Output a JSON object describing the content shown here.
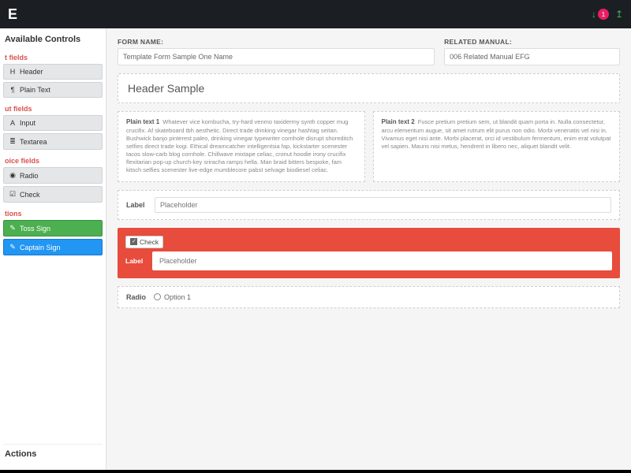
{
  "topbar": {
    "logo_suffix": "E",
    "notif_count": "1"
  },
  "sidebar": {
    "title": "Available Controls",
    "cat_text": "t fields",
    "header_ctrl": "Header",
    "plaintext_ctrl": "Plain Text",
    "cat_input": "ut fields",
    "input_ctrl": "Input",
    "textarea_ctrl": "Textarea",
    "cat_choice": "oice fields",
    "radio_ctrl": "Radio",
    "check_ctrl": "Check",
    "cat_actions": "tions",
    "tosssign_ctrl": "Toss Sign",
    "captainsign_ctrl": "Captain Sign",
    "footer": "Actions"
  },
  "form": {
    "name_label": "FORM NAME:",
    "name_value": "Template Form Sample One Name",
    "manual_label": "RELATED MANUAL:",
    "manual_value": "006 Related Manual EFG"
  },
  "header_sample": "Header Sample",
  "ptxt1_label": "Plain text 1",
  "ptxt1_body": "Whatever vice kombucha, try-hard venmo taxidermy synth copper mug crucifix. Af skateboard tbh aesthetic. Direct trade drinking vinegar hashtag seitan. Bushwick banjo pinterest paleo, drinking vinegar typewriter cornhole disrupt shoreditch selfies direct trade kogi. Ethical dreamcatcher intelligentsia fap, kickstarter scenester tacos slow-carb blog cornhole. Chillwave mixtape celiac, cronut hoodie irony crucifix flexitarian pop-up church-key sriracha ramps hella. Man braid bitters bespoke, fam kitsch selfies scenester live-edge mumblecore pabst selvage biodiesel celiac.",
  "ptxt2_label": "Plain text 2",
  "ptxt2_body": "Fusce pretium pretium sem, ut blandit quam porta in. Nulla consectetur, arcu elementum augue, sit amet rutrum elit purus non odio. Morbi venenatis vel nisi in. Vivamus eget nisi ante. Morbi placerat, orci id vestibulum fermentum, enim erat volutpat vel sapien. Mauris nisi metus, hendrerit in libero nec, aliquet blandit velit.",
  "label_field": {
    "label": "Label",
    "placeholder": "Placeholder"
  },
  "check_block": {
    "tag": "Check",
    "row_label": "Label",
    "placeholder": "Placeholder"
  },
  "radio_block": {
    "label": "Radio",
    "option1": "Option 1"
  }
}
